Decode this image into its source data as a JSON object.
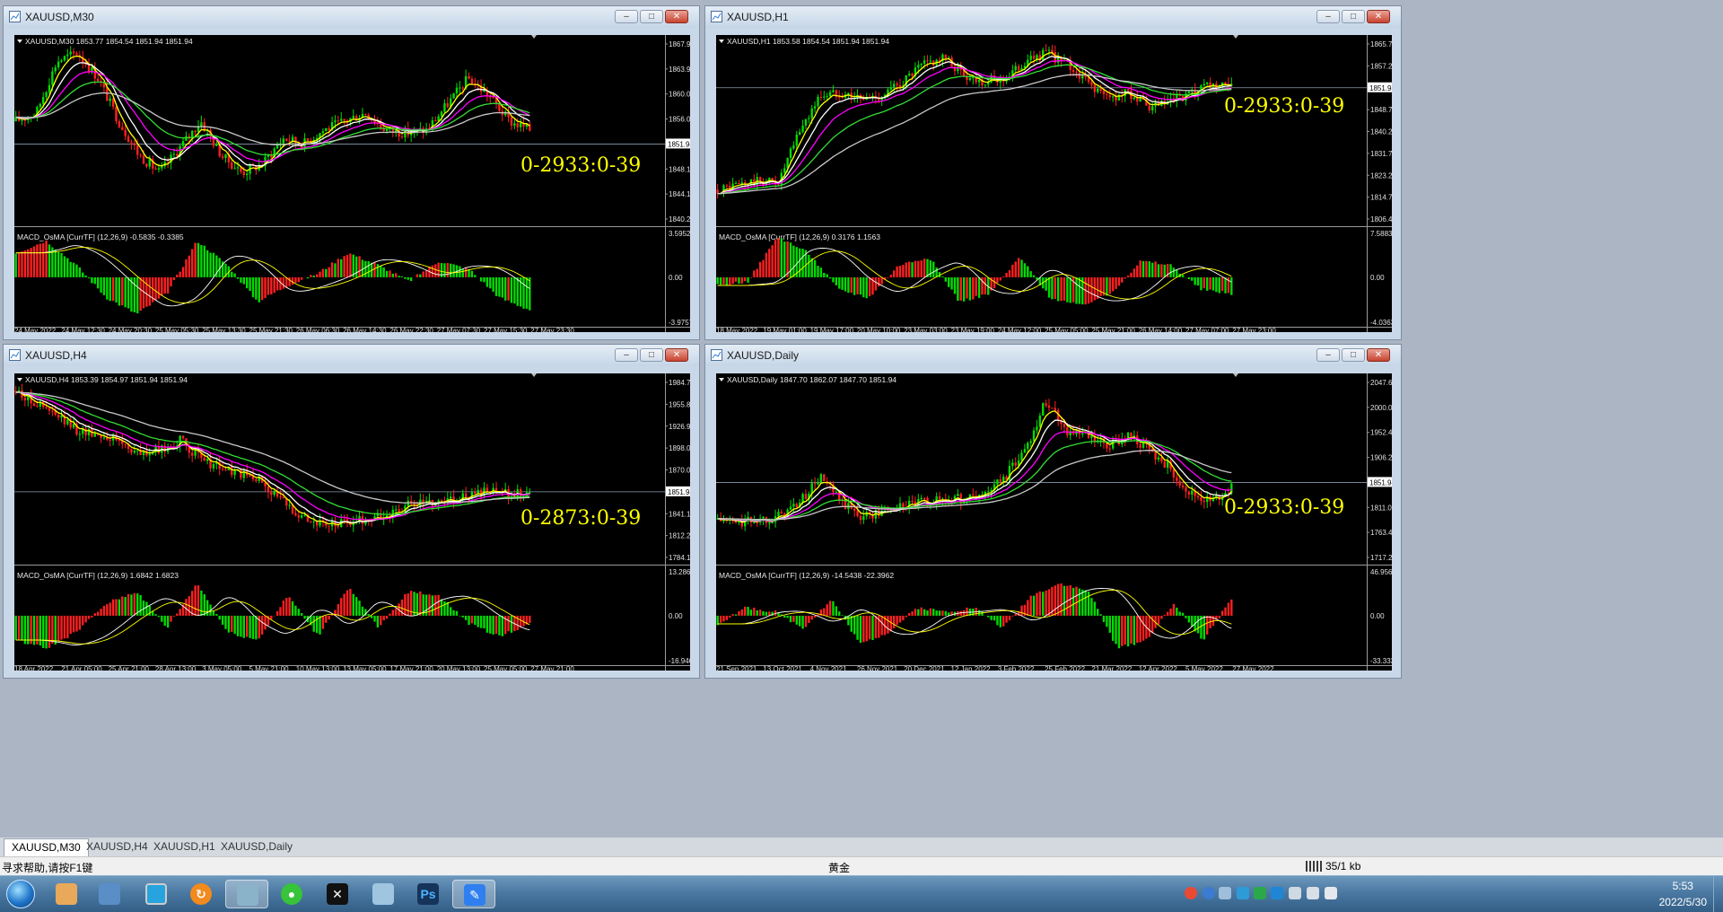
{
  "windows": [
    {
      "id": "m30",
      "title": "XAUUSD,M30",
      "header": "XAUUSD,M30  1853.77 1854.54 1851.94 1851.94",
      "price_ticks": [
        "1867.90",
        "1863.90",
        "1860.00",
        "1856.00",
        "1851.94",
        "1848.10",
        "1844.10",
        "1840.20"
      ],
      "current_price": "1851.94",
      "overlay": "0-2933:0-39",
      "macd_header": "MACD_OsMA [CurrTF] (12,26,9) -0.5835 -0.3385",
      "macd_ticks": [
        "3.5952",
        "0.00",
        "-3.9757"
      ],
      "time_ticks": [
        "24 May 2022",
        "24 May 12:30",
        "24 May 20:30",
        "25 May 05:30",
        "25 May 13:30",
        "25 May 21:30",
        "26 May 06:30",
        "26 May 14:30",
        "26 May 22:30",
        "27 May 07:30",
        "27 May 15:30",
        "27 May 23:30"
      ]
    },
    {
      "id": "h1",
      "title": "XAUUSD,H1",
      "header": "XAUUSD,H1  1853.58 1854.54 1851.94 1851.94",
      "price_ticks": [
        "1865.70",
        "1857.20",
        "1851.94",
        "1848.70",
        "1840.20",
        "1831.70",
        "1823.20",
        "1814.70",
        "1806.45"
      ],
      "current_price": "1851.94",
      "overlay": "0-2933:0-39",
      "macd_header": "MACD_OsMA [CurrTF] (12,26,9) 0.3176 1.1563",
      "macd_ticks": [
        "7.5883",
        "0.00",
        "-4.0363"
      ],
      "time_ticks": [
        "18 May 2022",
        "19 May 01:00",
        "19 May 17:00",
        "20 May 10:00",
        "23 May 03:00",
        "23 May 19:00",
        "24 May 12:00",
        "25 May 05:00",
        "25 May 21:00",
        "26 May 14:00",
        "27 May 07:00",
        "27 May 23:00"
      ]
    },
    {
      "id": "h4",
      "title": "XAUUSD,H4",
      "header": "XAUUSD,H4  1853.39 1854.97 1851.94 1851.94",
      "price_ticks": [
        "1984.75",
        "1955.85",
        "1926.95",
        "1898.05",
        "1870.00",
        "1851.94",
        "1841.10",
        "1812.20",
        "1784.15"
      ],
      "current_price": "1851.94",
      "overlay": "0-2873:0-39",
      "macd_header": "MACD_OsMA [CurrTF] (12,26,9) 1.6842 1.6823",
      "macd_ticks": [
        "13.2861",
        "0.00",
        "-16.9466"
      ],
      "time_ticks": [
        "18 Apr 2022",
        "21 Apr 05:00",
        "25 Apr 21:00",
        "28 Apr 13:00",
        "3 May 05:00",
        "5 May 21:00",
        "10 May 13:00",
        "13 May 05:00",
        "17 May 21:00",
        "20 May 13:00",
        "25 May 05:00",
        "27 May 21:00"
      ]
    },
    {
      "id": "daily",
      "title": "XAUUSD,Daily",
      "header": "XAUUSD,Daily  1847.70 1862.07 1847.70 1851.94",
      "price_ticks": [
        "2047.60",
        "2000.00",
        "1952.40",
        "1906.20",
        "1851.94",
        "1811.00",
        "1763.40",
        "1717.20"
      ],
      "current_price": "1851.94",
      "overlay": "0-2933:0-39",
      "macd_header": "MACD_OsMA [CurrTF] (12,26,9) -14.5438 -22.3962",
      "macd_ticks": [
        "46.9566",
        "0.00",
        "-33.333"
      ],
      "time_ticks": [
        "21 Sep 2021",
        "13 Oct 2021",
        "4 Nov 2021",
        "26 Nov 2021",
        "20 Dec 2021",
        "12 Jan 2022",
        "3 Feb 2022",
        "25 Feb 2022",
        "21 Mar 2022",
        "12 Apr 2022",
        "5 May 2022",
        "27 May 2022"
      ]
    }
  ],
  "tabs": [
    "XAUUSD,M30",
    "XAUUSD,H4",
    "XAUUSD,H1",
    "XAUUSD,Daily"
  ],
  "status": {
    "help": "寻求帮助,请按F1键",
    "symbol": "黄金",
    "traffic": "35/1 kb"
  },
  "clock": {
    "time": "5:53",
    "date": "2022/5/30"
  },
  "colors": {
    "bull": "#00dd00",
    "bear": "#ff2020",
    "ma_fast": "#ffff00",
    "ma_mid": "#ff00ff",
    "ma_slow": "#33dd33",
    "ma_long": "#c8c8c8",
    "overlay": "#ffff00",
    "background": "#000000"
  }
}
